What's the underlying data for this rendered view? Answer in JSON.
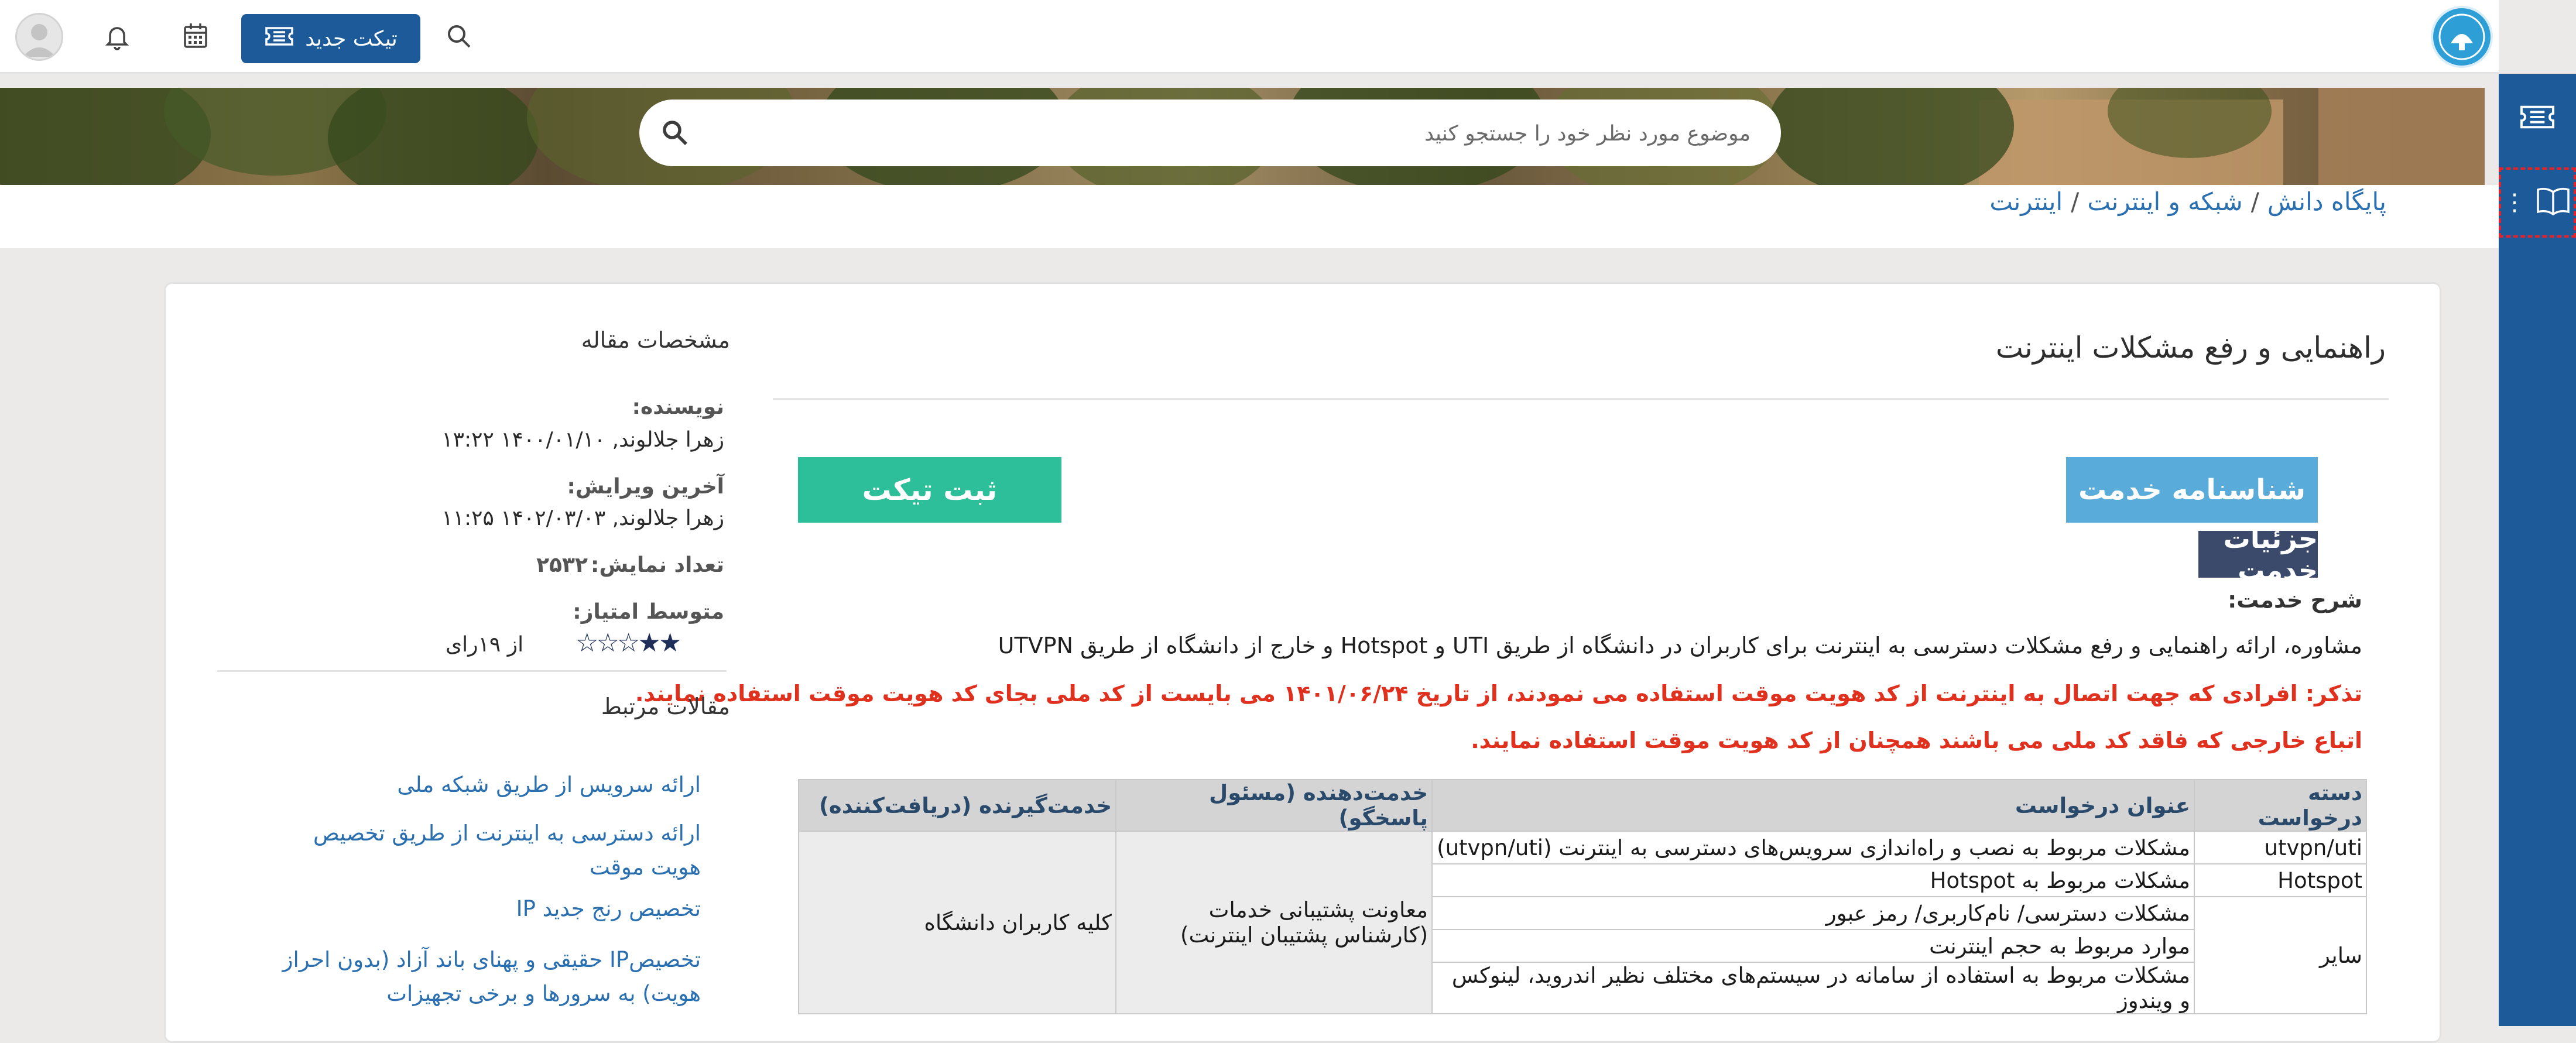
{
  "header": {
    "new_ticket_label": "تیکت جدید",
    "icons": [
      "search-icon",
      "calendar-icon",
      "bell-icon",
      "avatar"
    ]
  },
  "sidebar": {
    "items": [
      {
        "icon": "ticket-icon"
      },
      {
        "icon": "book-icon",
        "active": true
      }
    ]
  },
  "search": {
    "placeholder": "موضوع مورد نظر خود را جستجو کنید"
  },
  "breadcrumb": {
    "items": [
      "پایگاه دانش",
      "شبکه و اینترنت",
      "اینترنت"
    ],
    "separator": "/"
  },
  "article": {
    "title": "راهنمایی و رفع مشکلات اینترنت",
    "submit_ticket_label": "ثبت تیکت",
    "service_id_label": "شناسنامه خدمت",
    "service_details_label": "جزئیات خدمت",
    "service_desc_label": "شرح خدمت:",
    "service_desc": "مشاوره، ارائه راهنمایی و رفع مشکلات دسترسی به اینترنت برای کاربران در دانشگاه از طریق UTI و Hotspot و خارج از دانشگاه از طریق UTVPN",
    "note_1": "تذکر: افرادی که جهت اتصال به اینترنت از کد هویت موقت استفاده می نمودند، از تاریخ ۱۴۰۱/۰۶/۲۴ می بایست از کد ملی بجای کد هویت موقت استفاده نمایند.",
    "note_2": "اتباع خارجی که فاقد کد ملی می باشند همچنان از کد هویت موقت استفاده نمایند."
  },
  "table": {
    "headers": [
      "دسته درخواست",
      "عنوان درخواست",
      "خدمت‌دهنده (مسئول پاسخگو)",
      "خدمت‌گیرنده (دریافت‌کننده)"
    ],
    "rows": [
      {
        "category": "utvpn/uti",
        "title": "مشکلات مربوط به نصب و راه‌اندازی سرویس‌های دسترسی به اینترنت (utvpn/uti)"
      },
      {
        "category": "Hotspot",
        "title": "مشکلات مربوط به Hotspot"
      },
      {
        "category": "سایر",
        "title": "مشکلات دسترسی/ نام‌کاربری/ رمز عبور"
      },
      {
        "category": "",
        "title": "موارد مربوط به حجم اینترنت"
      },
      {
        "category": "",
        "title": "مشکلات مربوط به استفاده از سامانه در سیستم‌های مختلف نظیر اندروید، لینوکس و ویندوز"
      }
    ],
    "provider": "معاونت پشتیبانی خدمات (کارشناس پشتیبان اینترنت)",
    "recipient": "کلیه کاربران دانشگاه"
  },
  "article_info": {
    "heading": "مشخصات مقاله",
    "author_label": "نویسنده:",
    "author_value": "زهرا جلالوند, ۱۴۰۰/۰۱/۱۰ ۱۳:۲۲",
    "last_edit_label": "آخرین ویرایش:",
    "last_edit_value": "زهرا جلالوند, ۱۴۰۲/۰۳/۰۳ ۱۱:۲۵",
    "views_label": "تعداد نمایش:",
    "views_value": "۲۵۳۲",
    "rating_label": "متوسط امتیاز:",
    "rating_stars": 2,
    "rating_max": 5,
    "rating_votes": "از ۱۹رای"
  },
  "related": {
    "heading": "مقالات مرتبط",
    "links": [
      "ارائه سرویس از طریق شبکه ملی",
      "ارائه دسترسی به اینترنت از طریق تخصیص هویت موقت",
      "تخصیص رنج جدید IP",
      "تخصیصIP حقیقی و پهنای باند آزاد (بدون احراز هویت) به سرورها و برخی تجهیزات"
    ]
  },
  "colors": {
    "brand": "#1c5a99",
    "teal": "#2cbf9a",
    "light_blue": "#59acd9",
    "dark_badge": "#3b4a6b",
    "alert_red": "#e0301e",
    "link": "#2a6fb0"
  }
}
